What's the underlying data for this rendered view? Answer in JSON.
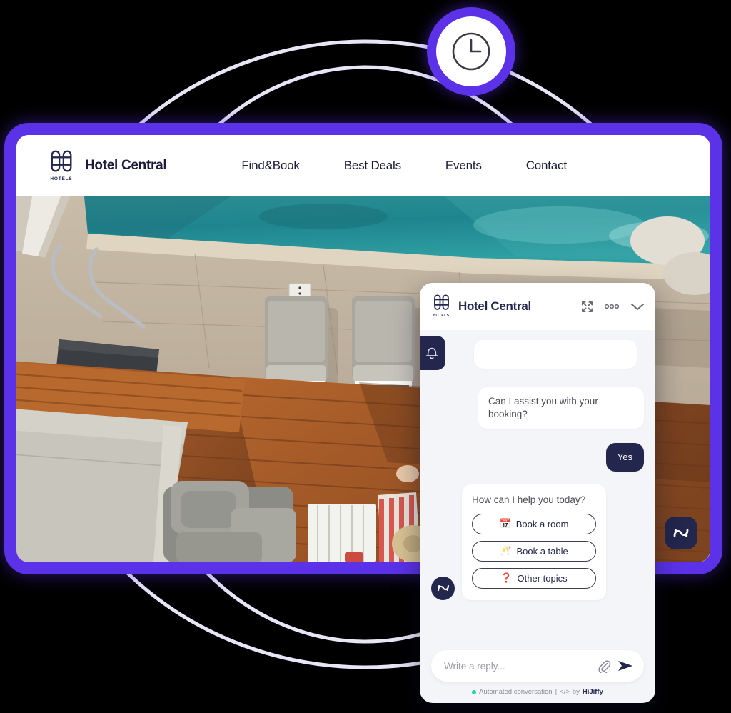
{
  "site": {
    "brand_name": "Hotel Central",
    "logo_caption": "HOTELS",
    "logo_icon": "hotel-beds-icon",
    "nav_links": [
      {
        "label": "Find&Book"
      },
      {
        "label": "Best Deals"
      },
      {
        "label": "Events"
      },
      {
        "label": "Contact"
      }
    ],
    "hero_image_alt": "aerial view of hotel pool deck with sun loungers"
  },
  "clock_badge": {
    "icon": "clock-icon"
  },
  "launcher": {
    "icon": "hijiffy-logo-icon"
  },
  "chat": {
    "title": "Hotel Central",
    "logo_caption": "HOTELS",
    "logo_icon": "hotel-beds-icon",
    "header_actions": [
      {
        "name": "expand-icon",
        "label": "expand"
      },
      {
        "name": "more-options-icon",
        "label": "more options"
      },
      {
        "name": "chevron-down-icon",
        "label": "minimize"
      }
    ],
    "notification": {
      "icon": "bell-icon"
    },
    "messages": [
      {
        "from": "bot",
        "text": "",
        "empty": true
      },
      {
        "from": "bot",
        "text": "Can I assist you with your booking?"
      },
      {
        "from": "user",
        "text": "Yes"
      }
    ],
    "quick_reply_card": {
      "question": "How can I help you today?",
      "avatar_icon": "hijiffy-avatar-icon",
      "options": [
        {
          "emoji": "📅",
          "label": "Book a room"
        },
        {
          "emoji": "🥂",
          "label": "Book a table"
        },
        {
          "emoji": "❓",
          "label": "Other topics"
        }
      ]
    },
    "composer": {
      "placeholder": "Write a reply...",
      "value": "",
      "attach_icon": "paperclip-icon",
      "send_icon": "send-icon"
    },
    "footer": {
      "status_dot": "online-dot",
      "status_text": "Automated conversation",
      "separator": "|",
      "code_icon": "</>",
      "by_text": "by",
      "vendor": "HiJiffy"
    }
  },
  "colors": {
    "accent_purple": "#5B32E8",
    "navy": "#23264D",
    "chat_bg": "#F4F5F9",
    "online_green": "#1ED79C"
  }
}
